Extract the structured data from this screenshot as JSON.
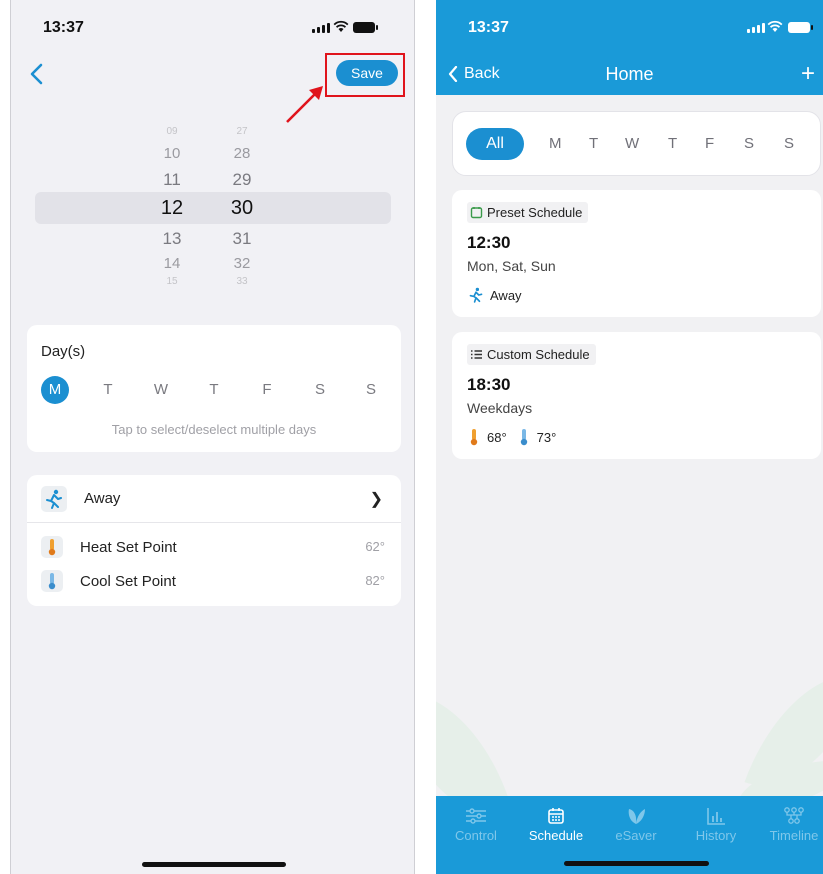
{
  "left_screen": {
    "status": {
      "time": "13:37"
    },
    "nav": {
      "save_label": "Save"
    },
    "picker": {
      "hours": [
        "09",
        "10",
        "11",
        "12",
        "13",
        "14",
        "15"
      ],
      "minutes": [
        "27",
        "28",
        "29",
        "30",
        "31",
        "32",
        "33"
      ],
      "selected_hour": "12",
      "selected_minute": "30"
    },
    "days_card": {
      "title": "Day(s)",
      "days": [
        "M",
        "T",
        "W",
        "T",
        "F",
        "S",
        "S"
      ],
      "selected_day": "M",
      "hint": "Tap to select/deselect multiple days"
    },
    "mode_card": {
      "mode_label": "Away",
      "heat_label": "Heat Set Point",
      "heat_value": "62°",
      "cool_label": "Cool Set Point",
      "cool_value": "82°"
    }
  },
  "right_screen": {
    "status": {
      "time": "13:37"
    },
    "header": {
      "back_label": "Back",
      "title": "Home",
      "add_label": "+"
    },
    "filter": {
      "all_label": "All",
      "days": [
        "M",
        "T",
        "W",
        "T",
        "F",
        "S",
        "S"
      ]
    },
    "schedules": [
      {
        "type": "Preset Schedule",
        "time": "12:30",
        "days": "Mon, Sat, Sun",
        "mode": "Away"
      },
      {
        "type": "Custom Schedule",
        "time": "18:30",
        "days": "Weekdays",
        "heat": "68°",
        "cool": "73°"
      }
    ],
    "tabs": [
      {
        "label": "Control",
        "icon": "sliders-icon",
        "active": false
      },
      {
        "label": "Schedule",
        "icon": "calendar-icon",
        "active": true
      },
      {
        "label": "eSaver",
        "icon": "leaf-icon",
        "active": false
      },
      {
        "label": "History",
        "icon": "bar-chart-icon",
        "active": false
      },
      {
        "label": "Timeline",
        "icon": "timeline-icon",
        "active": false
      }
    ]
  },
  "colors": {
    "accent": "#1b8fd1",
    "header_blue": "#1a9ad8",
    "annotation_red": "#e0141c"
  }
}
